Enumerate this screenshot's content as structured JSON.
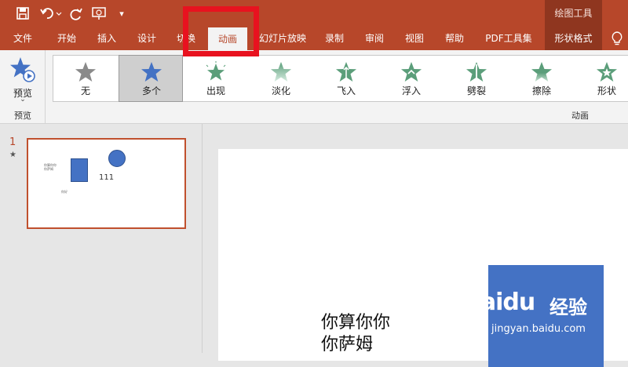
{
  "titlebar": {
    "context_title": "绘图工具"
  },
  "tabs": [
    {
      "label": "文件"
    },
    {
      "label": "开始"
    },
    {
      "label": "插入"
    },
    {
      "label": "设计"
    },
    {
      "label": "切换"
    },
    {
      "label": "动画"
    },
    {
      "label": "幻灯片放映"
    },
    {
      "label": "录制"
    },
    {
      "label": "审阅"
    },
    {
      "label": "视图"
    },
    {
      "label": "帮助"
    },
    {
      "label": "PDF工具集"
    },
    {
      "label": "形状格式"
    }
  ],
  "ribbon": {
    "preview": {
      "label": "预览",
      "group_label": "预览"
    },
    "animation_group_label": "动画",
    "gallery": [
      {
        "label": "无",
        "color": "#8a8a8a",
        "selected": false
      },
      {
        "label": "多个",
        "color": "#4472c4",
        "selected": true
      },
      {
        "label": "出现",
        "color": "#5b9e7a",
        "selected": false
      },
      {
        "label": "淡化",
        "color": "#8fc4a8",
        "selected": false
      },
      {
        "label": "飞入",
        "color": "#5b9e7a",
        "selected": false
      },
      {
        "label": "浮入",
        "color": "#5b9e7a",
        "selected": false
      },
      {
        "label": "劈裂",
        "color": "#5b9e7a",
        "selected": false
      },
      {
        "label": "擦除",
        "color": "#7fb897",
        "selected": false
      },
      {
        "label": "形状",
        "color": "#5b9e7a",
        "selected": false
      }
    ]
  },
  "slides_pane": {
    "slide_number": "1",
    "star_marker": "★",
    "thumb_text_1": "你算你你",
    "thumb_text_2": "你萨姆",
    "thumb_small": "你好",
    "thumb_label": "111"
  },
  "slide": {
    "text_line_1": "你算你你",
    "text_line_2": "你萨姆"
  },
  "watermark": {
    "logo": "Baidu",
    "cn": "经验",
    "url": "jingyan.baidu.com"
  },
  "colors": {
    "brand": "#b7472a",
    "highlight": "#e8121f",
    "shape_blue": "#4472c4"
  }
}
